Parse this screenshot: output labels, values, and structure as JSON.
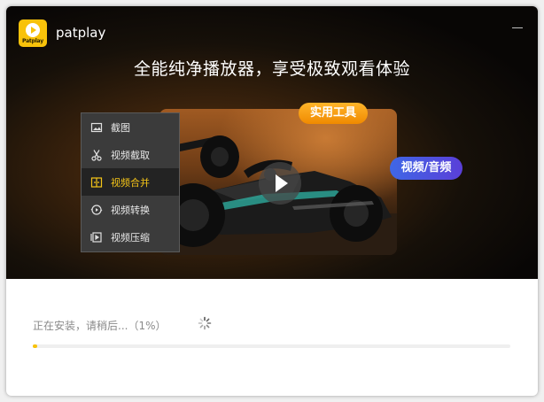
{
  "app": {
    "name": "patplay",
    "logo_text": "Patplay",
    "headline": "全能纯净播放器，享受极致观看体验"
  },
  "badges": {
    "tools": "实用工具",
    "video_audio": "视频/音频"
  },
  "menu": {
    "items": [
      {
        "label": "截图",
        "icon": "screenshot-icon",
        "active": false
      },
      {
        "label": "视频截取",
        "icon": "scissors-icon",
        "active": false
      },
      {
        "label": "视频合并",
        "icon": "merge-icon",
        "active": true
      },
      {
        "label": "视频转换",
        "icon": "convert-icon",
        "active": false
      },
      {
        "label": "视频压缩",
        "icon": "compress-icon",
        "active": false
      }
    ]
  },
  "install": {
    "status": "正在安装，请稍后...（1%）",
    "progress_percent": 1
  },
  "colors": {
    "brand_yellow": "#f8c20a",
    "tools_badge": "#f59a0c",
    "video_badge": "#4a55e0",
    "menu_active_text": "#f5c518"
  }
}
